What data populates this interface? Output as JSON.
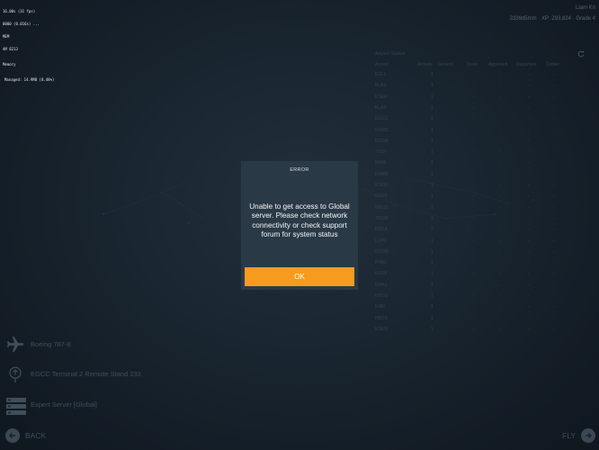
{
  "debug": {
    "lines": [
      "16.00s (31 fps)",
      "0000 (0.016s) ...",
      "MEM",
      "AM 8213"
    ],
    "memory_label": "Memory",
    "managed": "Managed: 14.9MB (8.48%)"
  },
  "top_right": {
    "line1": "Liam Kri",
    "line2": "3339d5mm · XP: 293,824 · Grade 4"
  },
  "airport_status": {
    "title": "Airport Status",
    "columns": [
      "Airport",
      "Arrivals",
      "Ground",
      "Tower",
      "Approach",
      "Departure",
      "Center"
    ],
    "rows": [
      [
        "EGLL",
        "1",
        "-",
        "-",
        "-",
        "-",
        "-"
      ],
      [
        "KLAX",
        "1",
        "-",
        "-",
        "-",
        "-",
        "-"
      ],
      [
        "KSEA",
        "1",
        "-",
        "-",
        "-",
        "-",
        "-"
      ],
      [
        "KLAS",
        "1",
        "-",
        "-",
        "-",
        "-",
        "-"
      ],
      [
        "EGCC",
        "1",
        "-",
        "-",
        "-",
        "-",
        "-"
      ],
      [
        "KORD",
        "1",
        "-",
        "-",
        "-",
        "-",
        "-"
      ],
      [
        "EDDM",
        "1",
        "-",
        "-",
        "-",
        "-",
        "-"
      ],
      [
        "YSSY",
        "1",
        "-",
        "-",
        "-",
        "-",
        "-"
      ],
      [
        "KMIA",
        "1",
        "-",
        "-",
        "-",
        "-",
        "-"
      ],
      [
        "KHAM",
        "1",
        "-",
        "-",
        "-",
        "-",
        "-"
      ],
      [
        "KSFO",
        "1",
        "-",
        "-",
        "-",
        "-",
        "-"
      ],
      [
        "EGKK",
        "1",
        "-",
        "-",
        "-",
        "-",
        "-"
      ],
      [
        "MROC",
        "1",
        "-",
        "-",
        "-",
        "-",
        "-"
      ],
      [
        "TNCM",
        "1",
        "-",
        "-",
        "-",
        "-",
        "-"
      ],
      [
        "KDCA",
        "1",
        "-",
        "-",
        "-",
        "-",
        "-"
      ],
      [
        "LFPG",
        "1",
        "-",
        "-",
        "-",
        "-",
        "-"
      ],
      [
        "KEWR",
        "1",
        "-",
        "-",
        "-",
        "-",
        "-"
      ],
      [
        "PHNL",
        "1",
        "-",
        "-",
        "-",
        "-",
        "-"
      ],
      [
        "KPDX",
        "1",
        "-",
        "-",
        "-",
        "-",
        "-"
      ],
      [
        "KPHX",
        "1",
        "-",
        "-",
        "-",
        "-",
        "-"
      ],
      [
        "KBOS",
        "1",
        "-",
        "-",
        "-",
        "-",
        "-"
      ],
      [
        "KIAD",
        "1",
        "-",
        "-",
        "-",
        "-",
        "-"
      ],
      [
        "KBOS",
        "1",
        "-",
        "-",
        "-",
        "-",
        "-"
      ],
      [
        "KDEN",
        "1",
        "-",
        "-",
        "-",
        "-",
        "-"
      ]
    ]
  },
  "dialog": {
    "title": "ERROR",
    "message": "Unable to get access to Global server. Please check network connectivity or check support forum for system status",
    "ok_label": "OK"
  },
  "aircraft": {
    "label": "Boeing 787-8",
    "icon": "airplane-icon"
  },
  "location": {
    "label": "EGCC Terminal 2 Remote Stand 233",
    "icon": "map-pin-icon"
  },
  "server": {
    "label": "Expert Server [Global]",
    "icon": "server-icon"
  },
  "nav": {
    "back_label": "BACK",
    "fly_label": "FLY"
  },
  "colors": {
    "accent": "#f79b1e",
    "dialog_bg": "#2a3946",
    "background": "#17222c"
  }
}
